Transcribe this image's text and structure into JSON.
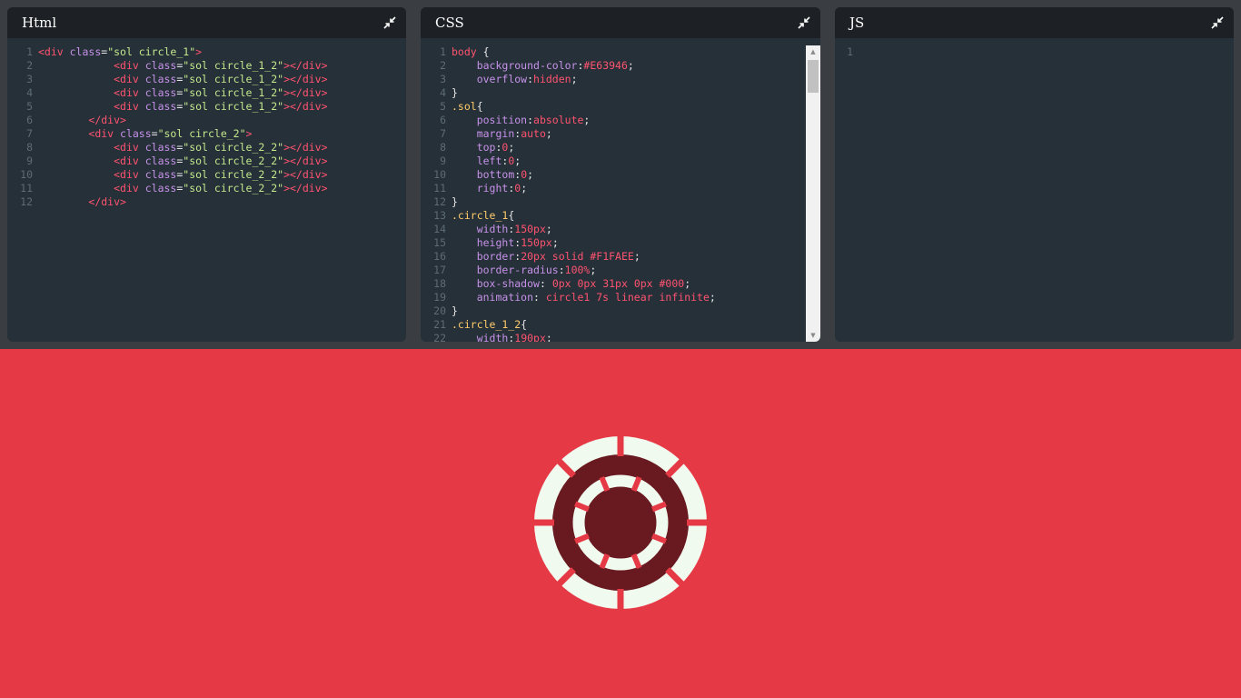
{
  "panels": {
    "html": {
      "title": "Html"
    },
    "css": {
      "title": "CSS"
    },
    "js": {
      "title": "JS"
    }
  },
  "html_code": [
    [
      [
        "t-tag",
        "<div "
      ],
      [
        "t-attr",
        "class"
      ],
      [
        "t-punc",
        "="
      ],
      [
        "t-str",
        "\"sol circle_1\""
      ],
      [
        "t-tag",
        ">"
      ]
    ],
    [
      [
        "t-punc",
        "            "
      ],
      [
        "t-tag",
        "<div "
      ],
      [
        "t-attr",
        "class"
      ],
      [
        "t-punc",
        "="
      ],
      [
        "t-str",
        "\"sol circle_1_2\""
      ],
      [
        "t-tag",
        "></div>"
      ]
    ],
    [
      [
        "t-punc",
        "            "
      ],
      [
        "t-tag",
        "<div "
      ],
      [
        "t-attr",
        "class"
      ],
      [
        "t-punc",
        "="
      ],
      [
        "t-str",
        "\"sol circle_1_2\""
      ],
      [
        "t-tag",
        "></div>"
      ]
    ],
    [
      [
        "t-punc",
        "            "
      ],
      [
        "t-tag",
        "<div "
      ],
      [
        "t-attr",
        "class"
      ],
      [
        "t-punc",
        "="
      ],
      [
        "t-str",
        "\"sol circle_1_2\""
      ],
      [
        "t-tag",
        "></div>"
      ]
    ],
    [
      [
        "t-punc",
        "            "
      ],
      [
        "t-tag",
        "<div "
      ],
      [
        "t-attr",
        "class"
      ],
      [
        "t-punc",
        "="
      ],
      [
        "t-str",
        "\"sol circle_1_2\""
      ],
      [
        "t-tag",
        "></div>"
      ]
    ],
    [
      [
        "t-punc",
        "        "
      ],
      [
        "t-tag",
        "</div>"
      ]
    ],
    [
      [
        "t-punc",
        "        "
      ],
      [
        "t-tag",
        "<div "
      ],
      [
        "t-attr",
        "class"
      ],
      [
        "t-punc",
        "="
      ],
      [
        "t-str",
        "\"sol circle_2\""
      ],
      [
        "t-tag",
        ">"
      ]
    ],
    [
      [
        "t-punc",
        "            "
      ],
      [
        "t-tag",
        "<div "
      ],
      [
        "t-attr",
        "class"
      ],
      [
        "t-punc",
        "="
      ],
      [
        "t-str",
        "\"sol circle_2_2\""
      ],
      [
        "t-tag",
        "></div>"
      ]
    ],
    [
      [
        "t-punc",
        "            "
      ],
      [
        "t-tag",
        "<div "
      ],
      [
        "t-attr",
        "class"
      ],
      [
        "t-punc",
        "="
      ],
      [
        "t-str",
        "\"sol circle_2_2\""
      ],
      [
        "t-tag",
        "></div>"
      ]
    ],
    [
      [
        "t-punc",
        "            "
      ],
      [
        "t-tag",
        "<div "
      ],
      [
        "t-attr",
        "class"
      ],
      [
        "t-punc",
        "="
      ],
      [
        "t-str",
        "\"sol circle_2_2\""
      ],
      [
        "t-tag",
        "></div>"
      ]
    ],
    [
      [
        "t-punc",
        "            "
      ],
      [
        "t-tag",
        "<div "
      ],
      [
        "t-attr",
        "class"
      ],
      [
        "t-punc",
        "="
      ],
      [
        "t-str",
        "\"sol circle_2_2\""
      ],
      [
        "t-tag",
        "></div>"
      ]
    ],
    [
      [
        "t-punc",
        "        "
      ],
      [
        "t-tag",
        "</div>"
      ]
    ]
  ],
  "css_code": [
    [
      [
        "t-sel-body",
        "body"
      ],
      [
        "t-punc",
        " {"
      ]
    ],
    [
      [
        "t-punc",
        "    "
      ],
      [
        "t-prop",
        "background-color"
      ],
      [
        "t-punc",
        ":"
      ],
      [
        "t-val",
        "#E63946"
      ],
      [
        "t-punc",
        ";"
      ]
    ],
    [
      [
        "t-punc",
        "    "
      ],
      [
        "t-prop",
        "overflow"
      ],
      [
        "t-punc",
        ":"
      ],
      [
        "t-val",
        "hidden"
      ],
      [
        "t-punc",
        ";"
      ]
    ],
    [
      [
        "t-punc",
        "}"
      ]
    ],
    [
      [
        "t-sel",
        ".sol"
      ],
      [
        "t-punc",
        "{"
      ]
    ],
    [
      [
        "t-punc",
        "    "
      ],
      [
        "t-prop",
        "position"
      ],
      [
        "t-punc",
        ":"
      ],
      [
        "t-val",
        "absolute"
      ],
      [
        "t-punc",
        ";"
      ]
    ],
    [
      [
        "t-punc",
        "    "
      ],
      [
        "t-prop",
        "margin"
      ],
      [
        "t-punc",
        ":"
      ],
      [
        "t-val",
        "auto"
      ],
      [
        "t-punc",
        ";"
      ]
    ],
    [
      [
        "t-punc",
        "    "
      ],
      [
        "t-prop",
        "top"
      ],
      [
        "t-punc",
        ":"
      ],
      [
        "t-val",
        "0"
      ],
      [
        "t-punc",
        ";"
      ]
    ],
    [
      [
        "t-punc",
        "    "
      ],
      [
        "t-prop",
        "left"
      ],
      [
        "t-punc",
        ":"
      ],
      [
        "t-val",
        "0"
      ],
      [
        "t-punc",
        ";"
      ]
    ],
    [
      [
        "t-punc",
        "    "
      ],
      [
        "t-prop",
        "bottom"
      ],
      [
        "t-punc",
        ":"
      ],
      [
        "t-val",
        "0"
      ],
      [
        "t-punc",
        ";"
      ]
    ],
    [
      [
        "t-punc",
        "    "
      ],
      [
        "t-prop",
        "right"
      ],
      [
        "t-punc",
        ":"
      ],
      [
        "t-val",
        "0"
      ],
      [
        "t-punc",
        ";"
      ]
    ],
    [
      [
        "t-punc",
        "}"
      ]
    ],
    [
      [
        "t-sel",
        ".circle_1"
      ],
      [
        "t-punc",
        "{"
      ]
    ],
    [
      [
        "t-punc",
        "    "
      ],
      [
        "t-prop",
        "width"
      ],
      [
        "t-punc",
        ":"
      ],
      [
        "t-val",
        "150px"
      ],
      [
        "t-punc",
        ";"
      ]
    ],
    [
      [
        "t-punc",
        "    "
      ],
      [
        "t-prop",
        "height"
      ],
      [
        "t-punc",
        ":"
      ],
      [
        "t-val",
        "150px"
      ],
      [
        "t-punc",
        ";"
      ]
    ],
    [
      [
        "t-punc",
        "    "
      ],
      [
        "t-prop",
        "border"
      ],
      [
        "t-punc",
        ":"
      ],
      [
        "t-val",
        "20px solid #F1FAEE"
      ],
      [
        "t-punc",
        ";"
      ]
    ],
    [
      [
        "t-punc",
        "    "
      ],
      [
        "t-prop",
        "border-radius"
      ],
      [
        "t-punc",
        ":"
      ],
      [
        "t-val",
        "100%"
      ],
      [
        "t-punc",
        ";"
      ]
    ],
    [
      [
        "t-punc",
        "    "
      ],
      [
        "t-prop",
        "box-shadow"
      ],
      [
        "t-punc",
        ": "
      ],
      [
        "t-val",
        "0px 0px 31px 0px #000"
      ],
      [
        "t-punc",
        ";"
      ]
    ],
    [
      [
        "t-punc",
        "    "
      ],
      [
        "t-prop",
        "animation"
      ],
      [
        "t-punc",
        ": "
      ],
      [
        "t-val",
        "circle1 7s linear infinite"
      ],
      [
        "t-punc",
        ";"
      ]
    ],
    [
      [
        "t-punc",
        "}"
      ]
    ],
    [
      [
        "t-sel",
        ".circle_1_2"
      ],
      [
        "t-punc",
        "{"
      ]
    ],
    [
      [
        "t-punc",
        "    "
      ],
      [
        "t-prop",
        "width"
      ],
      [
        "t-punc",
        ":"
      ],
      [
        "t-val",
        "190px"
      ],
      [
        "t-punc",
        ";"
      ]
    ]
  ],
  "js_code": [
    []
  ],
  "colors": {
    "preview_bg": "#E63946",
    "ring": "#F1FAEE"
  },
  "icons": {
    "collapse": "collapse-arrows-icon"
  }
}
